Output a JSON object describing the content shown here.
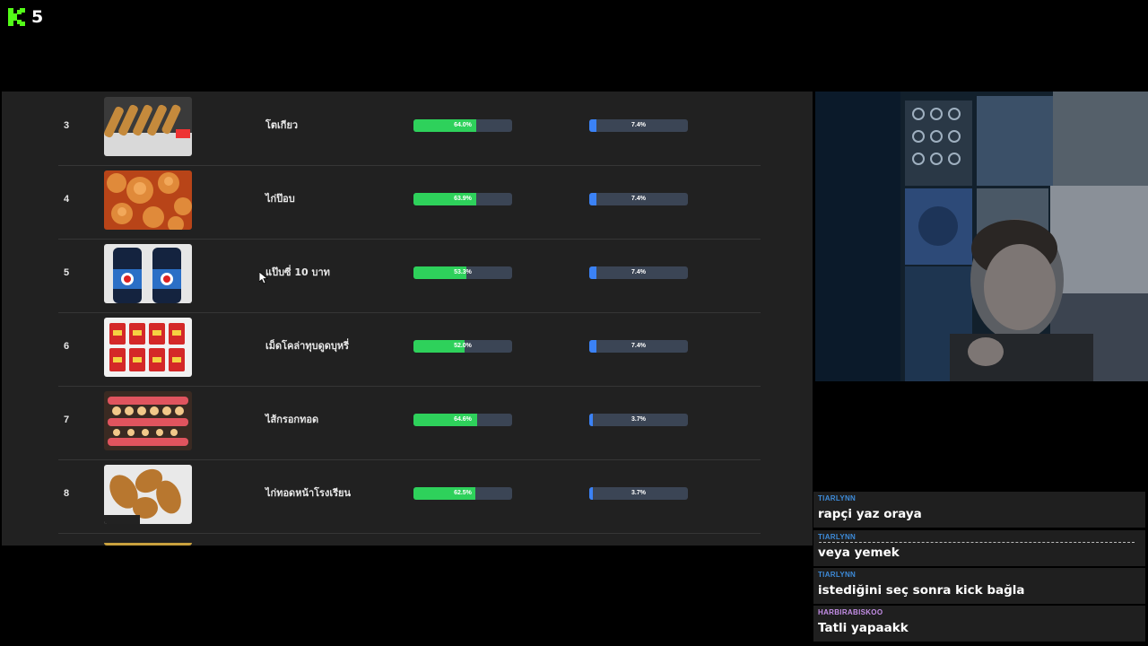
{
  "logo": {
    "icon": "kick-logo-icon",
    "number": "5",
    "brand_color": "#53fc18"
  },
  "ranking": {
    "rows": [
      {
        "rank": "3",
        "name": "โตเกียว",
        "green_pct": "64.0%",
        "green_fill": 64.0,
        "blue_pct": "7.4%",
        "blue_fill": 7.4
      },
      {
        "rank": "4",
        "name": "ไก่ป๊อบ",
        "green_pct": "63.9%",
        "green_fill": 63.9,
        "blue_pct": "7.4%",
        "blue_fill": 7.4
      },
      {
        "rank": "5",
        "name": "แป๊บซี่ 10 บาท",
        "green_pct": "53.3%",
        "green_fill": 53.3,
        "blue_pct": "7.4%",
        "blue_fill": 7.4
      },
      {
        "rank": "6",
        "name": "เม็ดโคล่าทุบดูดบุหรี่",
        "green_pct": "52.0%",
        "green_fill": 52.0,
        "blue_pct": "7.4%",
        "blue_fill": 7.4
      },
      {
        "rank": "7",
        "name": "ไส้กรอกทอด",
        "green_pct": "64.6%",
        "green_fill": 64.6,
        "blue_pct": "3.7%",
        "blue_fill": 3.7
      },
      {
        "rank": "8",
        "name": "ไก่ทอดหน้าโรงเรียน",
        "green_pct": "62.5%",
        "green_fill": 62.5,
        "blue_pct": "3.7%",
        "blue_fill": 3.7
      }
    ],
    "colors": {
      "green": "#2ed15b",
      "blue": "#3b82f6",
      "track": "#3b4555"
    }
  },
  "chat": {
    "messages": [
      {
        "user": "TIARLYNN",
        "text": "rapçi yaz oraya",
        "user_color": "#3d8bd9"
      },
      {
        "user": "TIARLYNN",
        "text": "veya yemek",
        "user_color": "#3d8bd9"
      },
      {
        "user": "TIARLYNN",
        "text": "istediğini seç sonra kick bağla",
        "user_color": "#3d8bd9"
      },
      {
        "user": "HARBIRABISKOO",
        "text": "Tatli yapaakk",
        "user_color": "#c58fe8"
      }
    ]
  }
}
